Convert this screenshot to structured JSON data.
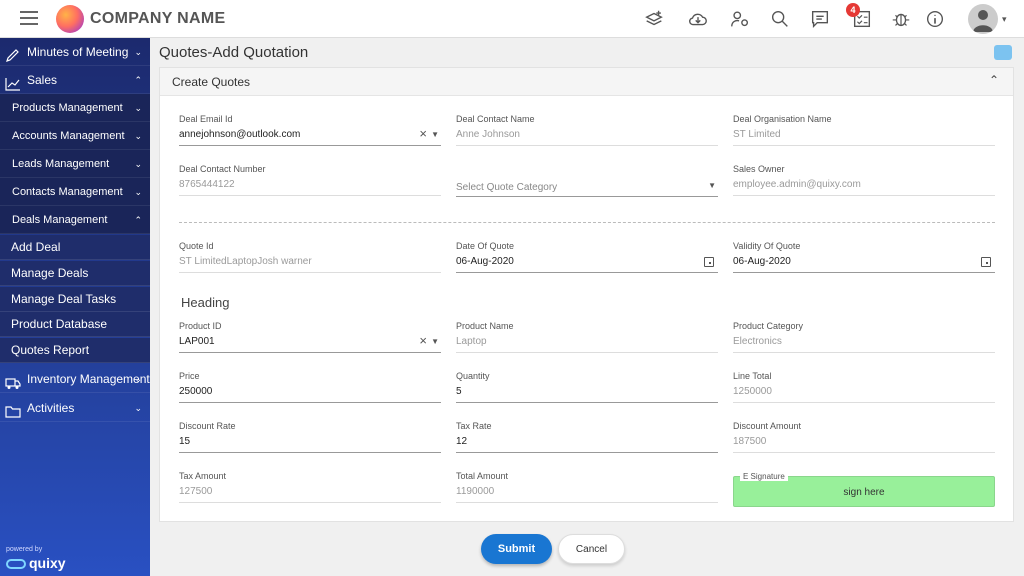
{
  "header": {
    "company_name": "COMPANY NAME",
    "notification_count": "4"
  },
  "sidebar": {
    "items": [
      {
        "label": "Minutes of Meeting",
        "icon": "pencil-icon"
      },
      {
        "label": "Sales",
        "icon": "chart-icon"
      },
      {
        "label": "Inventory Management",
        "icon": "truck-icon"
      },
      {
        "label": "Activities",
        "icon": "folder-icon"
      }
    ],
    "sales_sub": [
      {
        "label": "Products Management"
      },
      {
        "label": "Accounts Management"
      },
      {
        "label": "Leads Management"
      },
      {
        "label": "Contacts Management"
      },
      {
        "label": "Deals Management"
      }
    ],
    "deals_leaf": [
      {
        "label": "Add Deal"
      },
      {
        "label": "Manage Deals"
      },
      {
        "label": "Manage Deal Tasks"
      },
      {
        "label": "Product Database"
      },
      {
        "label": "Quotes Report"
      }
    ],
    "powered_by": "powered by",
    "brand": "quixy"
  },
  "page": {
    "title": "Quotes-Add Quotation",
    "section_title": "Create Quotes",
    "heading": "Heading"
  },
  "form": {
    "deal_email": {
      "label": "Deal Email Id",
      "value": "annejohnson@outlook.com"
    },
    "deal_contact_name": {
      "label": "Deal Contact Name",
      "value": "Anne Johnson"
    },
    "deal_org_name": {
      "label": "Deal Organisation Name",
      "value": "ST Limited"
    },
    "deal_contact_number": {
      "label": "Deal Contact Number",
      "value": "8765444122"
    },
    "quote_category": {
      "placeholder": "Select Quote Category"
    },
    "sales_owner": {
      "label": "Sales Owner",
      "value": "employee.admin@quixy.com"
    },
    "quote_id": {
      "label": "Quote Id",
      "value": "ST LimitedLaptopJosh warner"
    },
    "date_of_quote": {
      "label": "Date Of Quote",
      "value": "06-Aug-2020"
    },
    "validity_of_quote": {
      "label": "Validity Of Quote",
      "value": "06-Aug-2020"
    },
    "product_id": {
      "label": "Product ID",
      "value": "LAP001"
    },
    "product_name": {
      "label": "Product Name",
      "value": "Laptop"
    },
    "product_category": {
      "label": "Product Category",
      "value": "Electronics"
    },
    "price": {
      "label": "Price",
      "value": "250000"
    },
    "quantity": {
      "label": "Quantity",
      "value": "5"
    },
    "line_total": {
      "label": "Line Total",
      "value": "1250000"
    },
    "discount_rate": {
      "label": "Discount Rate",
      "value": "15"
    },
    "tax_rate": {
      "label": "Tax Rate",
      "value": "12"
    },
    "discount_amount": {
      "label": "Discount Amount",
      "value": "187500"
    },
    "tax_amount": {
      "label": "Tax Amount",
      "value": "127500"
    },
    "total_amount": {
      "label": "Total Amount",
      "value": "1190000"
    },
    "e_signature": {
      "label": "E Signature",
      "value": "sign here"
    }
  },
  "actions": {
    "submit": "Submit",
    "cancel": "Cancel"
  },
  "colors": {
    "primary": "#1976d2",
    "sidebar": "#24409b",
    "signature": "#98f09a"
  }
}
